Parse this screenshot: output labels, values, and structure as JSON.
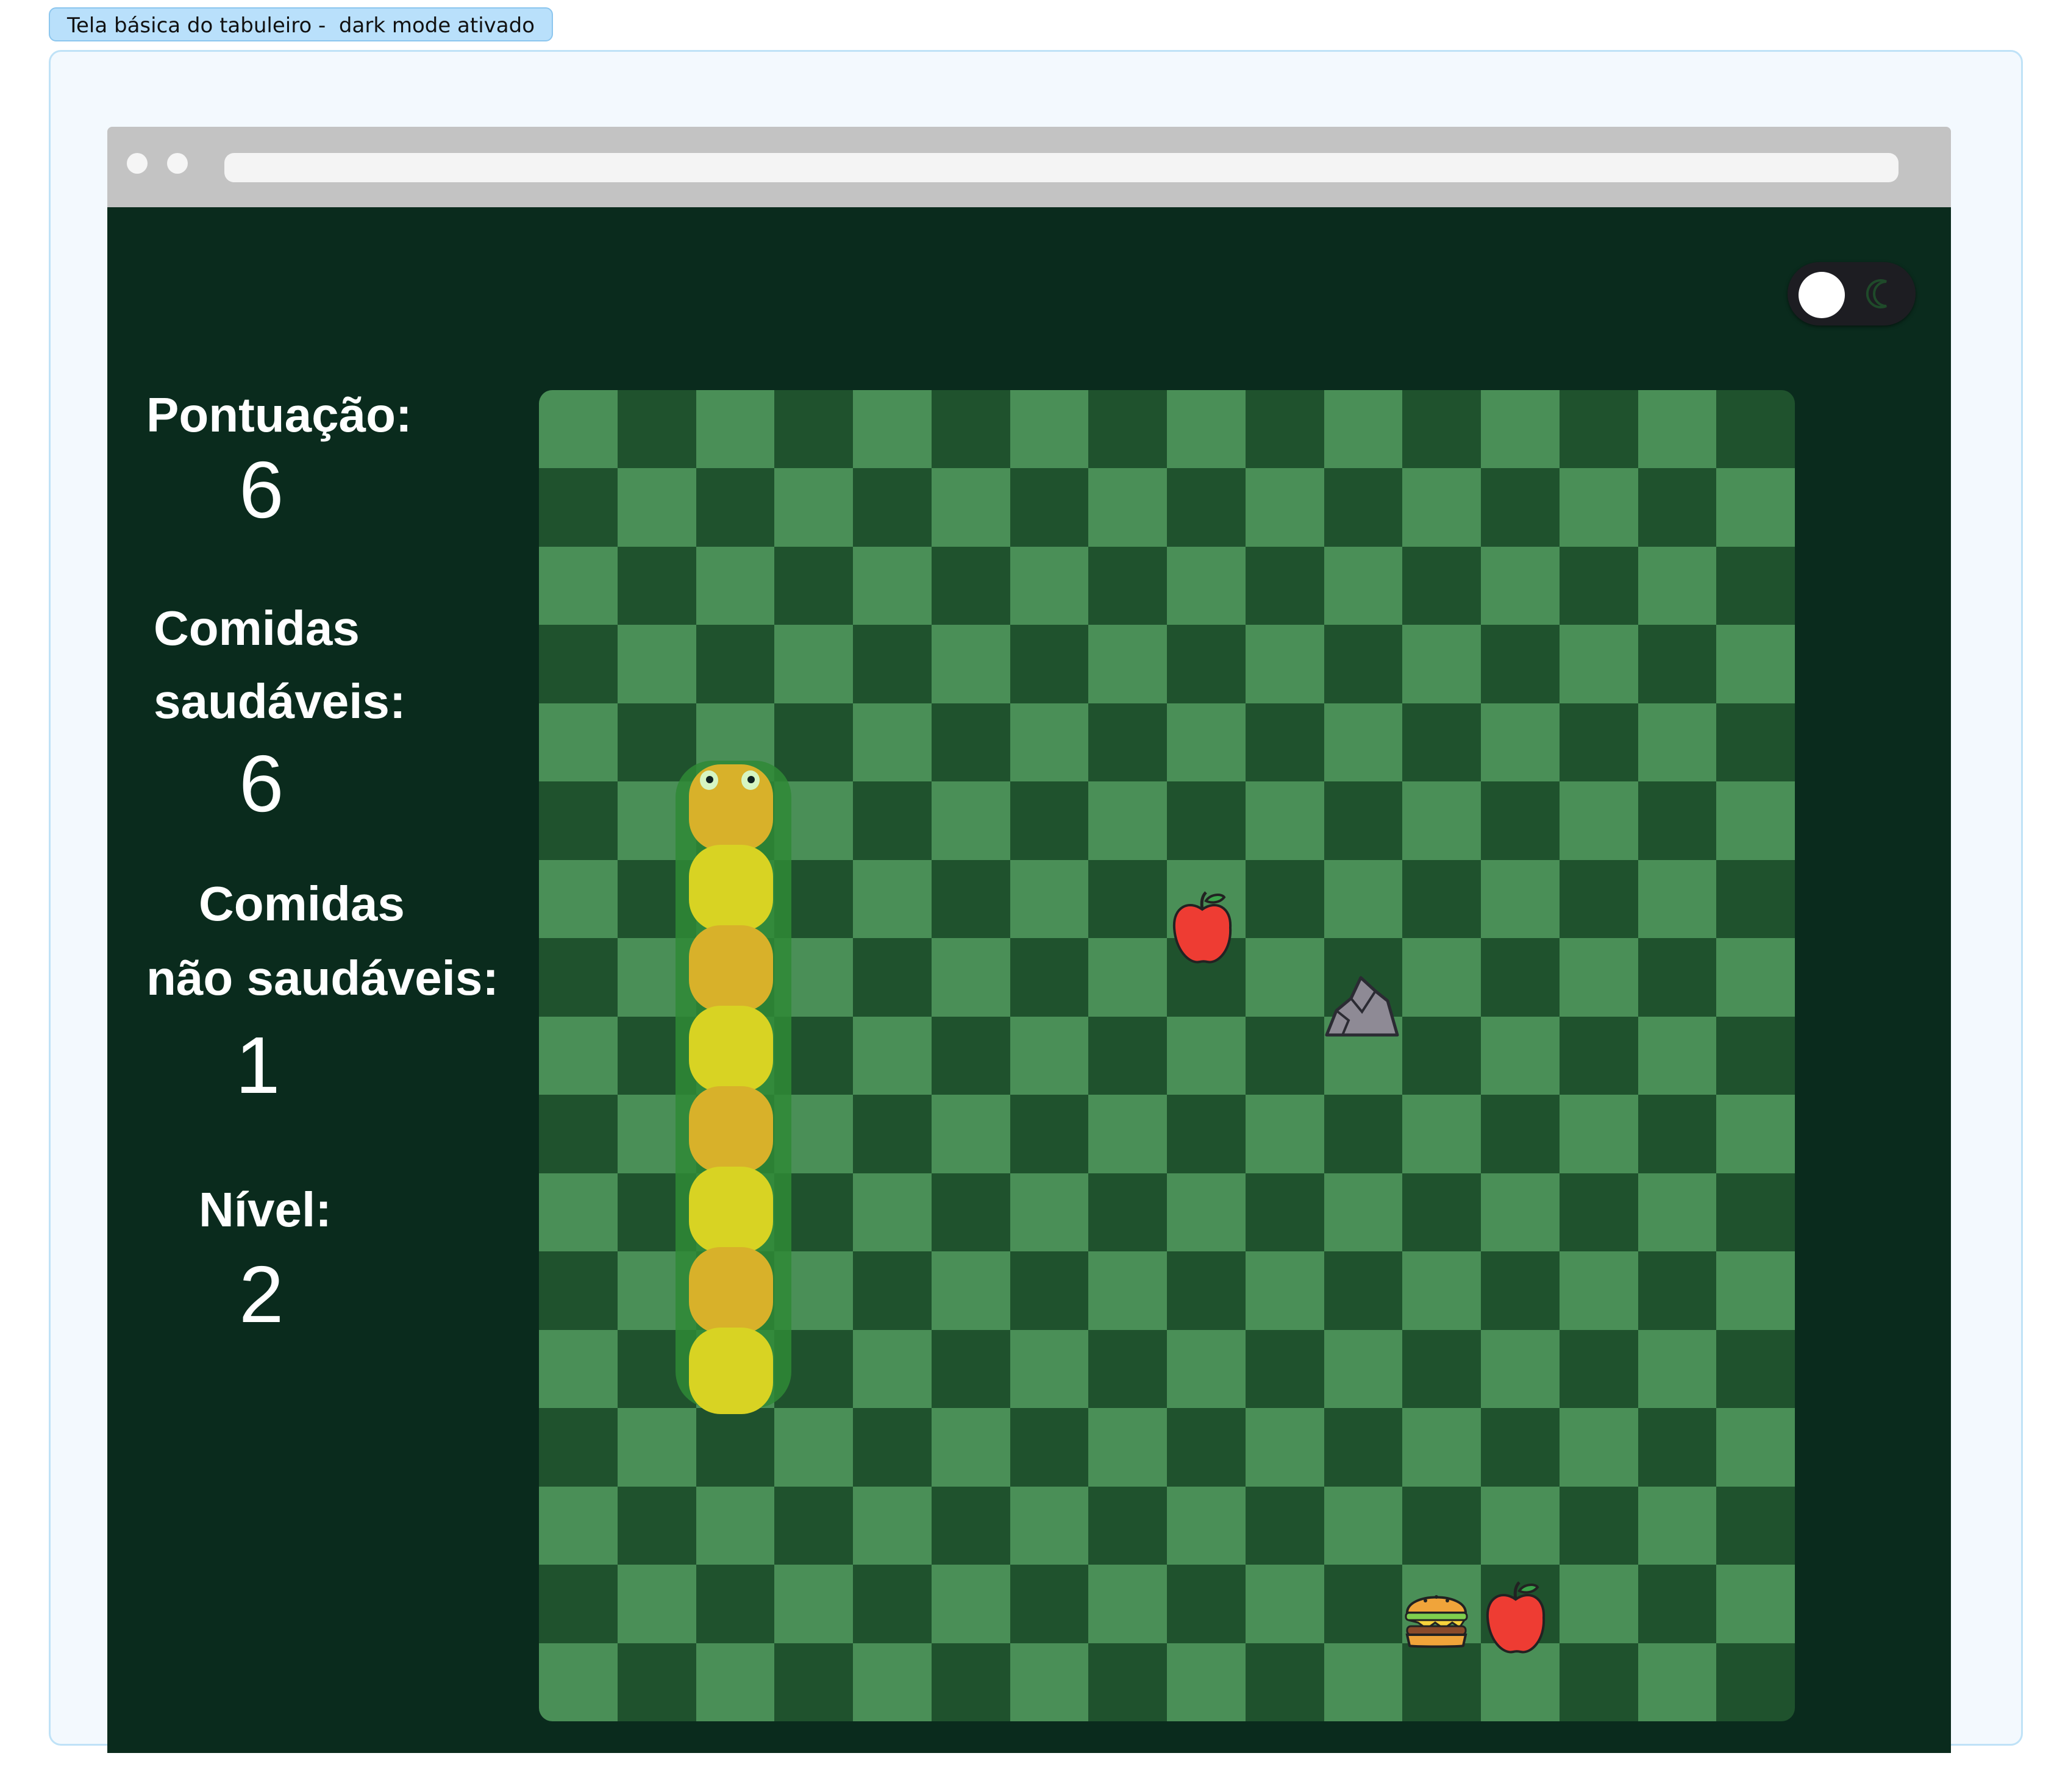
{
  "frame": {
    "label": "Tela básica do tabuleiro -  dark mode ativado"
  },
  "theme": {
    "viewport_bg": "#0a2b1d",
    "board_light": "#4a8f57",
    "board_dark": "#1f522d",
    "snake_orange": "#d8b12a",
    "snake_yellow": "#d8d323"
  },
  "toggle": {
    "state": "dark",
    "icon": "moon-icon"
  },
  "stats": {
    "score_label": "Pontuação:",
    "score_value": "6",
    "healthy_label_1": "Comidas",
    "healthy_label_2": "saudáveis:",
    "healthy_value": "6",
    "unhealthy_label_1": "Comidas",
    "unhealthy_label_2": "não saudáveis:",
    "unhealthy_value": "1",
    "level_label": "Nível:",
    "level_value": "2"
  },
  "board": {
    "columns": 16,
    "rows": 17,
    "items": [
      {
        "type": "apple",
        "icon": "apple-icon"
      },
      {
        "type": "rock",
        "icon": "rock-icon"
      },
      {
        "type": "burger",
        "icon": "burger-icon"
      },
      {
        "type": "apple",
        "icon": "apple-icon"
      }
    ],
    "snake_segments": 8
  }
}
